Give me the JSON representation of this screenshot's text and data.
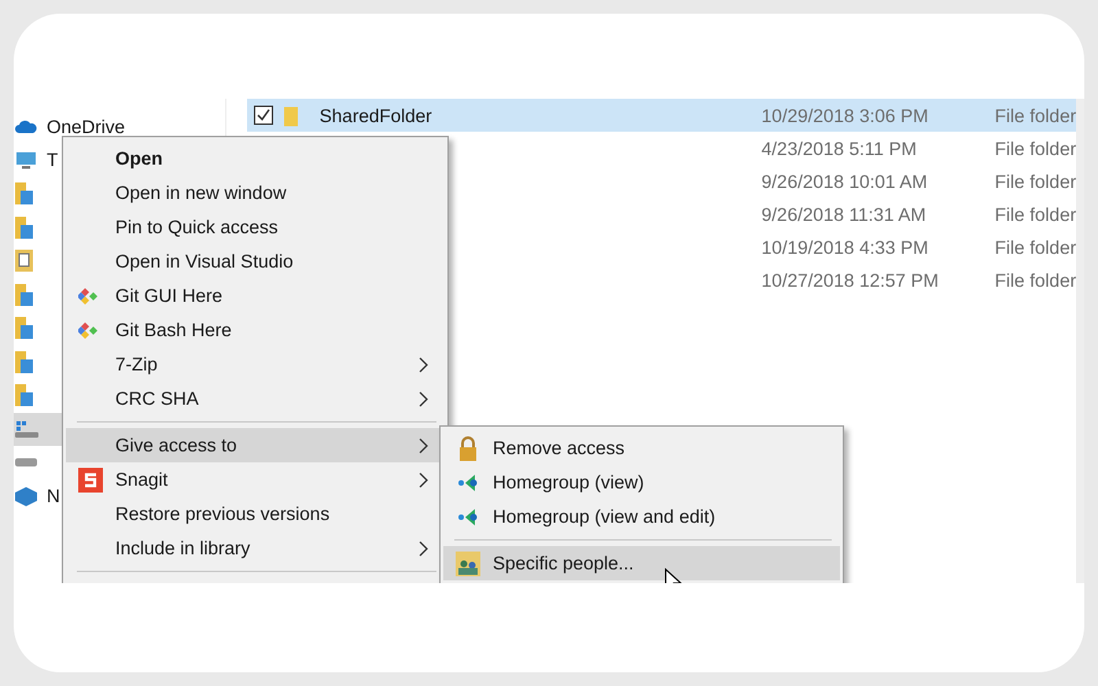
{
  "sidebar": {
    "items": [
      {
        "label": "OneDrive",
        "selected": false
      },
      {
        "label": "T",
        "selected": false
      },
      {
        "selected": false
      },
      {
        "selected": false
      },
      {
        "selected": false
      },
      {
        "selected": false
      },
      {
        "selected": false
      },
      {
        "selected": false
      },
      {
        "selected": false
      },
      {
        "selected": true
      },
      {
        "selected": false
      },
      {
        "label": "N",
        "selected": false
      }
    ]
  },
  "files": {
    "rows": [
      {
        "name": "SharedFolder",
        "date": "10/29/2018 3:06 PM",
        "type": "File folder",
        "selected": true,
        "checked": true
      },
      {
        "date": "4/23/2018 5:11 PM",
        "type": "File folder",
        "selected": false
      },
      {
        "date": "9/26/2018 10:01 AM",
        "type": "File folder",
        "selected": false
      },
      {
        "date": "9/26/2018 11:31 AM",
        "type": "File folder",
        "selected": false
      },
      {
        "date": "10/19/2018 4:33 PM",
        "type": "File folder",
        "selected": false
      },
      {
        "date": "10/27/2018 12:57 PM",
        "type": "File folder",
        "selected": false
      }
    ]
  },
  "context_menu": {
    "items": [
      {
        "kind": "item",
        "label": "Open",
        "default": true,
        "submenu": false,
        "selected": false
      },
      {
        "kind": "item",
        "label": "Open in new window",
        "default": false,
        "submenu": false,
        "selected": false
      },
      {
        "kind": "item",
        "label": "Pin to Quick access",
        "default": false,
        "submenu": false,
        "selected": false
      },
      {
        "kind": "item",
        "label": "Open in Visual Studio",
        "default": false,
        "submenu": false,
        "selected": false
      },
      {
        "kind": "item",
        "label": "Git GUI Here",
        "default": false,
        "submenu": false,
        "selected": false
      },
      {
        "kind": "item",
        "label": "Git Bash Here",
        "default": false,
        "submenu": false,
        "selected": false
      },
      {
        "kind": "item",
        "label": "7-Zip",
        "default": false,
        "submenu": true,
        "selected": false
      },
      {
        "kind": "item",
        "label": "CRC SHA",
        "default": false,
        "submenu": true,
        "selected": false
      },
      {
        "kind": "separator"
      },
      {
        "kind": "item",
        "label": "Give access to",
        "default": false,
        "submenu": true,
        "selected": true
      },
      {
        "kind": "item",
        "label": "Snagit",
        "default": false,
        "submenu": true,
        "selected": false
      },
      {
        "kind": "item",
        "label": "Restore previous versions",
        "default": false,
        "submenu": false,
        "selected": false
      },
      {
        "kind": "item",
        "label": "Include in library",
        "default": false,
        "submenu": true,
        "selected": false
      },
      {
        "kind": "separator"
      }
    ]
  },
  "submenu": {
    "items": [
      {
        "kind": "item",
        "label": "Remove access",
        "selected": false
      },
      {
        "kind": "item",
        "label": "Homegroup (view)",
        "selected": false
      },
      {
        "kind": "item",
        "label": "Homegroup (view and edit)",
        "selected": false
      },
      {
        "kind": "separator"
      },
      {
        "kind": "item",
        "label": "Specific people...",
        "selected": true
      }
    ]
  }
}
